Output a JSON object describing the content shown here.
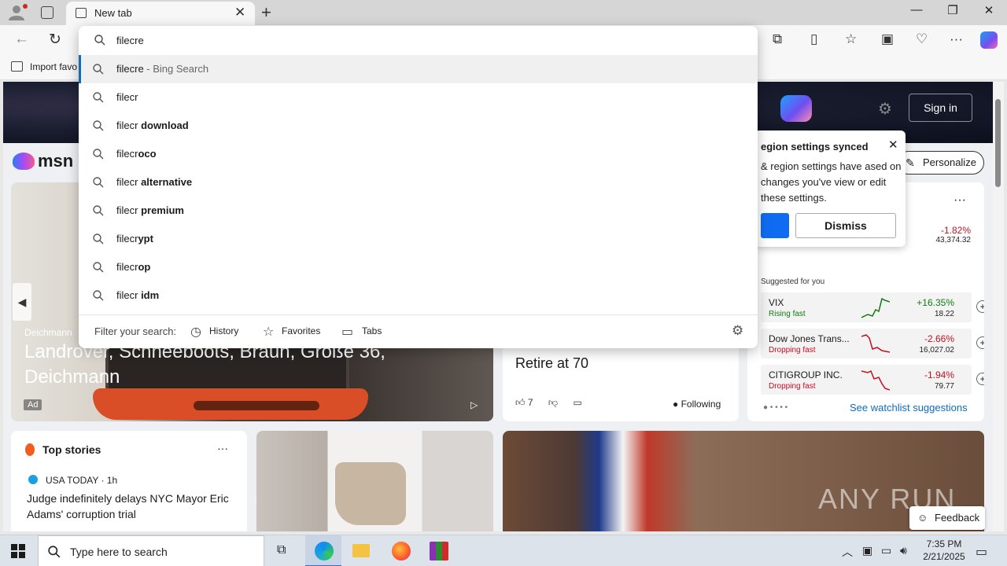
{
  "browser": {
    "tab_title": "New tab",
    "favorites_import": "Import favo"
  },
  "omnibox": {
    "value": "filecre",
    "suggestions": [
      {
        "prefix": "filecre",
        "bold": "",
        "sub": " - Bing Search"
      },
      {
        "prefix": "filecr",
        "bold": "",
        "sub": ""
      },
      {
        "prefix": "filecr ",
        "bold": "download",
        "sub": ""
      },
      {
        "prefix": "filecr",
        "bold": "oco",
        "sub": ""
      },
      {
        "prefix": "filecr ",
        "bold": "alternative",
        "sub": ""
      },
      {
        "prefix": "filecr ",
        "bold": "premium",
        "sub": ""
      },
      {
        "prefix": "filecr",
        "bold": "ypt",
        "sub": ""
      },
      {
        "prefix": "filecr",
        "bold": "op",
        "sub": ""
      },
      {
        "prefix": "filecr ",
        "bold": "idm",
        "sub": ""
      }
    ],
    "filter_label": "Filter your search:",
    "filters": [
      "History",
      "Favorites",
      "Tabs"
    ]
  },
  "msn": {
    "logo": "msn",
    "sign_in": "Sign in",
    "personalize": "Personalize",
    "hero": {
      "source": "Deichmann",
      "title": "Landrover, Schneeboots, Braun, Große 36, Deichmann",
      "ad": "Ad"
    },
    "story2": {
      "title": "Retire at 70",
      "likes": "7",
      "following": "Following"
    },
    "notice": {
      "title": "egion settings synced",
      "body": "& region settings have ased on changes you've view or edit these settings.",
      "dismiss": "Dismiss"
    },
    "markets": {
      "top_pct": "-1.82%",
      "top_val": "43,374.32",
      "suggested": "Suggested for you",
      "rows": [
        {
          "name": "VIX",
          "sub": "Rising fast",
          "pct": "+16.35%",
          "val": "18.22"
        },
        {
          "name": "Dow Jones Trans...",
          "sub": "Dropping fast",
          "pct": "-2.66%",
          "val": "16,027.02"
        },
        {
          "name": "CITIGROUP INC.",
          "sub": "Dropping fast",
          "pct": "-1.94%",
          "val": "79.77"
        }
      ],
      "see_watchlist": "See watchlist suggestions"
    },
    "top_stories": {
      "title": "Top stories",
      "source": "USA TODAY · 1h",
      "headline": "Judge indefinitely delays NYC Mayor Eric Adams' corruption trial"
    },
    "feedback": "Feedback",
    "watermark": "ANY RUN"
  },
  "taskbar": {
    "search_placeholder": "Type here to search",
    "time": "7:35 PM",
    "date": "2/21/2025"
  },
  "colors": {
    "accent": "#0f6cbd",
    "negative": "#c50f1f",
    "positive": "#107c10"
  }
}
